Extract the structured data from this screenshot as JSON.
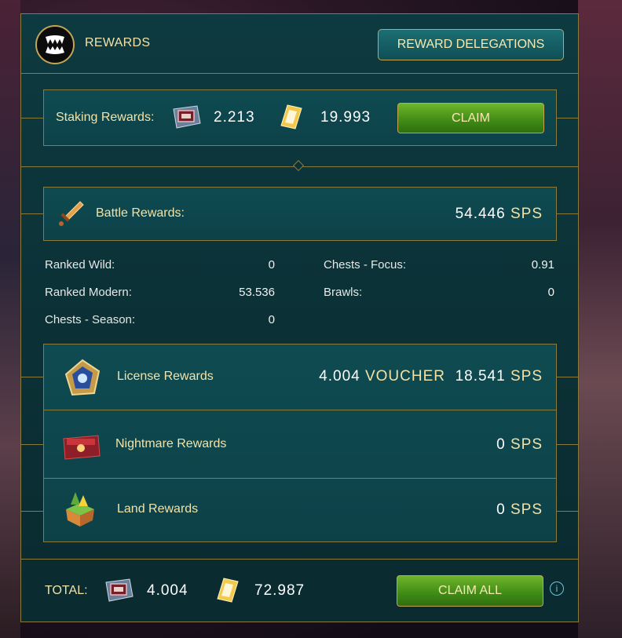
{
  "header": {
    "title": "REWARDS",
    "delegations_label": "REWARD DELEGATIONS"
  },
  "staking": {
    "label": "Staking Rewards:",
    "voucher_value": "2.213",
    "sps_value": "19.993",
    "claim_label": "CLAIM"
  },
  "battle": {
    "label": "Battle Rewards:",
    "value": "54.446",
    "unit": "SPS",
    "stats": [
      {
        "label": "Ranked Wild:",
        "value": "0"
      },
      {
        "label": "Ranked Modern:",
        "value": "53.536"
      },
      {
        "label": "Chests - Season:",
        "value": "0"
      },
      {
        "label": "Chests - Focus:",
        "value": "0.91"
      },
      {
        "label": "Brawls:",
        "value": "0"
      }
    ]
  },
  "license": {
    "label": "License Rewards",
    "voucher_value": "4.004",
    "voucher_unit": "VOUCHER",
    "sps_value": "18.541",
    "sps_unit": "SPS"
  },
  "nightmare": {
    "label": "Nightmare Rewards",
    "value": "0",
    "unit": "SPS"
  },
  "land": {
    "label": "Land Rewards",
    "value": "0",
    "unit": "SPS"
  },
  "total": {
    "label": "TOTAL:",
    "voucher_value": "4.004",
    "sps_value": "72.987",
    "claim_all_label": "CLAIM ALL"
  },
  "colors": {
    "gold": "#f1e3a8",
    "panel": "#0b3136",
    "green": "#4d9a1f",
    "border": "#8a7a3e"
  }
}
